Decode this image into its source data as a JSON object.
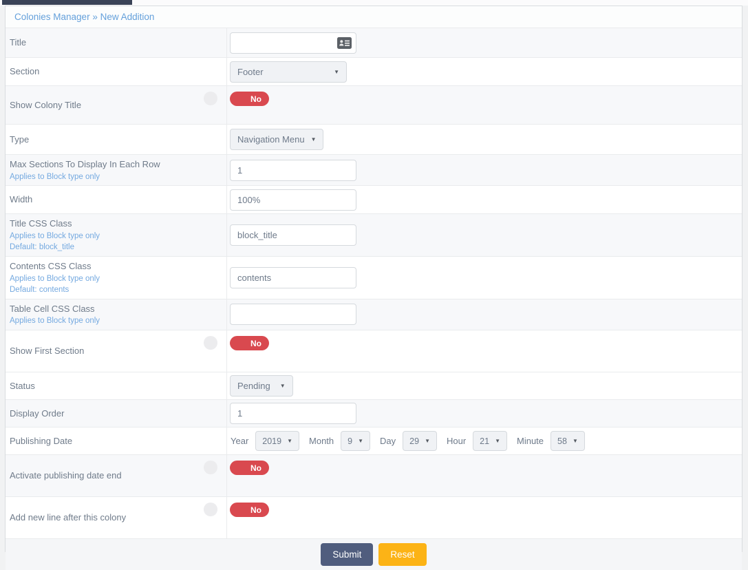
{
  "page": {
    "breadcrumb": "Colonies Manager » New Addition"
  },
  "icons": {
    "dropdown_arrow": "▼"
  },
  "colors": {
    "topbar": "#3a4357",
    "toggle_off_red": "#d9494f",
    "submit_blue": "#505d7e",
    "reset_orange": "#fcb316",
    "note_blue": "#74a9e0",
    "label_gray": "#6f7b8a"
  },
  "form": {
    "title": {
      "label": "Title",
      "value": ""
    },
    "section": {
      "label": "Section",
      "value": "Footer"
    },
    "show_colony_title": {
      "label": "Show Colony Title",
      "toggle": "No"
    },
    "type": {
      "label": "Type",
      "value": "Navigation Menu"
    },
    "max_sections": {
      "label": "Max Sections To Display In Each Row",
      "note": "Applies to Block type only",
      "value": "1"
    },
    "width": {
      "label": "Width",
      "value": "100%"
    },
    "title_css": {
      "label": "Title CSS Class",
      "note": "Applies to Block type only",
      "note2": "Default: block_title",
      "value": "block_title"
    },
    "contents_css": {
      "label": "Contents CSS Class",
      "note": "Applies to Block type only",
      "note2": "Default: contents",
      "value": "contents"
    },
    "table_cell_css": {
      "label": "Table Cell CSS Class",
      "note": "Applies to Block type only",
      "value": ""
    },
    "show_first_section": {
      "label": "Show First Section",
      "toggle": "No"
    },
    "status": {
      "label": "Status",
      "value": "Pending"
    },
    "display_order": {
      "label": "Display Order",
      "value": "1"
    },
    "publishing_date": {
      "label": "Publishing Date",
      "fields": [
        {
          "label": "Year",
          "value": "2019"
        },
        {
          "label": "Month",
          "value": "9"
        },
        {
          "label": "Day",
          "value": "29"
        },
        {
          "label": "Hour",
          "value": "21"
        },
        {
          "label": "Minute",
          "value": "58"
        }
      ]
    },
    "activate_end": {
      "label": "Activate publishing date end",
      "toggle": "No"
    },
    "add_new_line": {
      "label": "Add new line after this colony",
      "toggle": "No"
    },
    "submit_label": "Submit",
    "reset_label": "Reset"
  }
}
